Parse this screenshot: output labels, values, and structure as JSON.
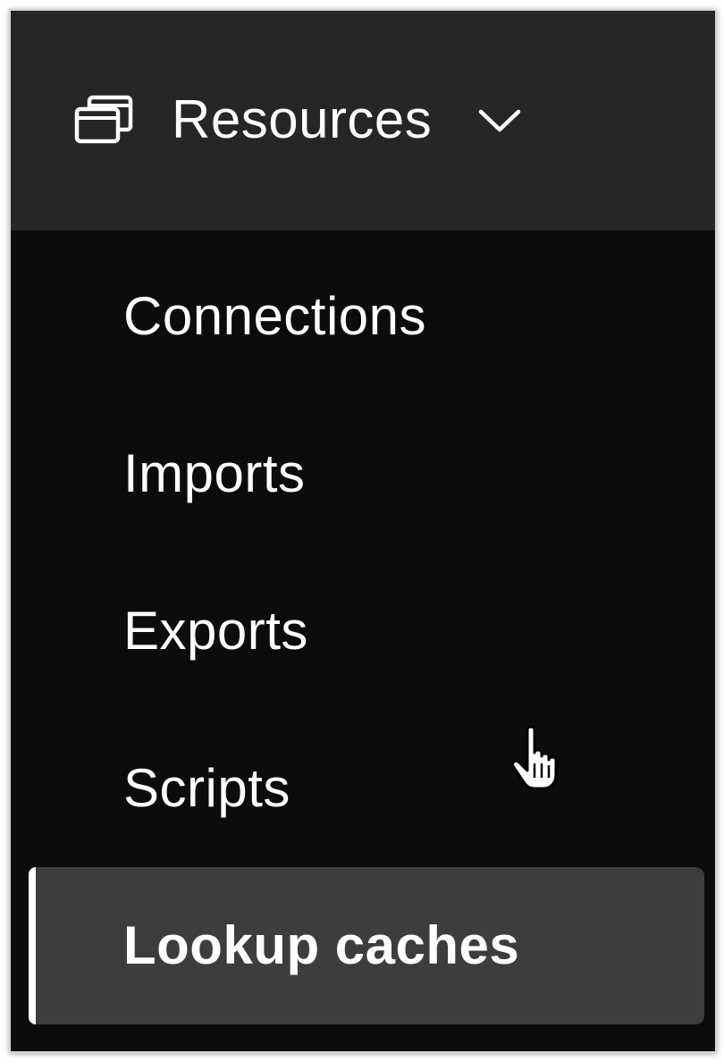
{
  "menu": {
    "header": {
      "label": "Resources",
      "icon": "windows-stack-icon",
      "chevron_icon": "chevron-down-icon"
    },
    "items": [
      {
        "label": "Connections",
        "active": false
      },
      {
        "label": "Imports",
        "active": false
      },
      {
        "label": "Exports",
        "active": false
      },
      {
        "label": "Scripts",
        "active": false
      },
      {
        "label": "Lookup caches",
        "active": true
      }
    ]
  },
  "colors": {
    "sidebar_background": "#0b0c0e",
    "header_background": "#262626",
    "active_item_background": "#3d3d3d",
    "active_indicator": "#ffffff",
    "text": "#ffffff"
  },
  "cursor": {
    "icon": "hand-pointer-cursor-icon"
  }
}
